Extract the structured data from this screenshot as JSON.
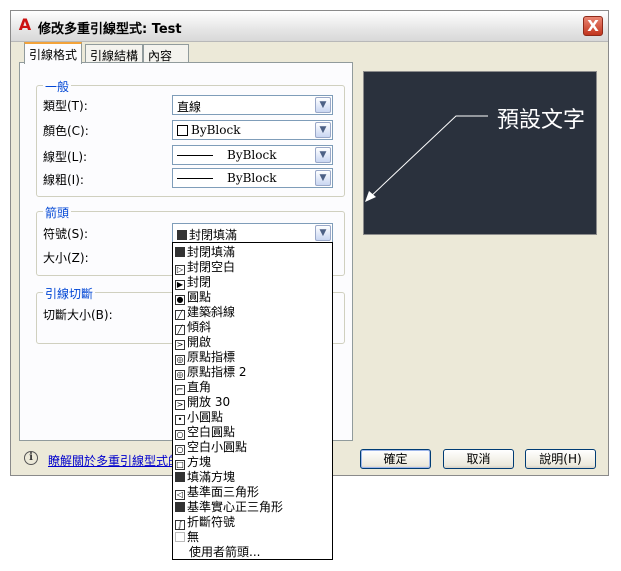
{
  "window": {
    "title": "修改多重引線型式: Test",
    "logo": "A",
    "close": "X"
  },
  "tabs": [
    {
      "label": "引線格式",
      "active": true
    },
    {
      "label": "引線結構",
      "active": false
    },
    {
      "label": "內容",
      "active": false
    }
  ],
  "general": {
    "legend": "一般",
    "type_label": "類型(T):",
    "type_value": "直線",
    "color_label": "顏色(C):",
    "color_value": "ByBlock",
    "linetype_label": "線型(L):",
    "linetype_value": "ByBlock",
    "lineweight_label": "線粗(I):",
    "lineweight_value": "ByBlock"
  },
  "arrowhead": {
    "legend": "箭頭",
    "symbol_label": "符號(S):",
    "symbol_value": "封閉填滿",
    "size_label": "大小(Z):"
  },
  "leader_break": {
    "legend": "引線切斷",
    "break_size_label": "切斷大小(B):"
  },
  "preview": {
    "text": "預設文字"
  },
  "info": {
    "link": "瞭解關於多重引線型式的"
  },
  "buttons": {
    "ok": "確定",
    "cancel": "取消",
    "help": "說明(H)"
  },
  "dropdown_items": [
    "封閉填滿",
    "封閉空白",
    "封閉",
    "圓點",
    "建築斜線",
    "傾斜",
    "開啟",
    "原點指標",
    "原點指標 2",
    "直角",
    "開放 30",
    "小圓點",
    "空白圓點",
    "空白小圓點",
    "方塊",
    "填滿方塊",
    "基準面三角形",
    "基準實心正三角形",
    "折斷符號",
    "無",
    "使用者箭頭..."
  ],
  "colors": {
    "preview_bg": "#2a313d",
    "group_legend": "#0046d5",
    "tab_highlight": "#f3a33a",
    "close_button": "#c2351e"
  }
}
